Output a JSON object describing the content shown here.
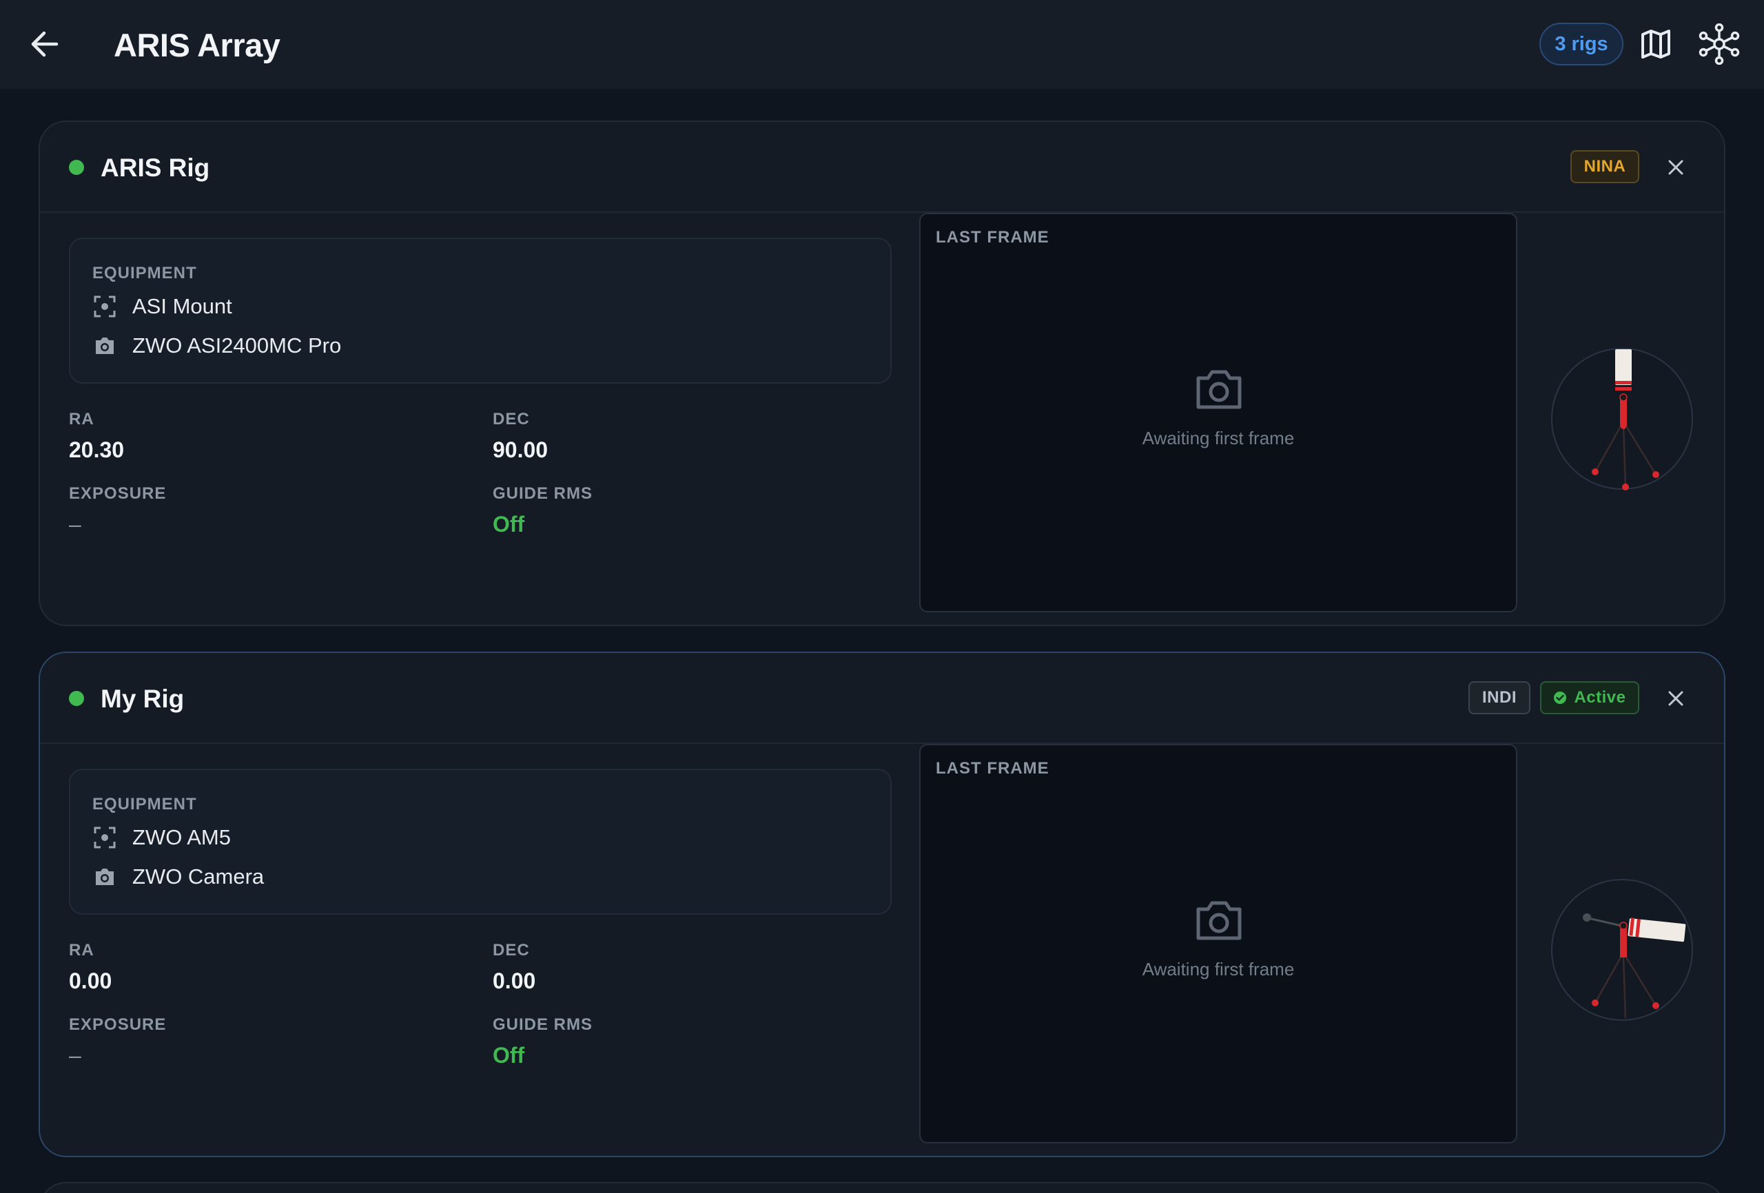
{
  "header": {
    "title": "ARIS Array",
    "rigs_count": "3 rigs",
    "icons": [
      "arrow-left-icon",
      "map-icon",
      "network-icon"
    ]
  },
  "rigs": [
    {
      "name": "ARIS Rig",
      "status_color": "#3fb950",
      "tags": [
        "NINA"
      ],
      "equipment_label": "EQUIPMENT",
      "equipment": [
        "ASI Mount",
        "ZWO ASI2400MC Pro"
      ],
      "ra_label": "RA",
      "ra": "20.30",
      "dec_label": "DEC",
      "dec": "90.00",
      "exposure_label": "EXPOSURE",
      "exposure": "–",
      "guide_label": "GUIDE RMS",
      "guide": "Off",
      "frame_label": "LAST FRAME",
      "frame_status": "Awaiting first frame",
      "scope_orientation": "vertical"
    },
    {
      "name": "My Rig",
      "status_color": "#3fb950",
      "tags": [
        "INDI",
        "Active"
      ],
      "equipment_label": "EQUIPMENT",
      "equipment": [
        "ZWO AM5",
        "ZWO Camera"
      ],
      "ra_label": "RA",
      "ra": "0.00",
      "dec_label": "DEC",
      "dec": "0.00",
      "exposure_label": "EXPOSURE",
      "exposure": "–",
      "guide_label": "GUIDE RMS",
      "guide": "Off",
      "frame_label": "LAST FRAME",
      "frame_status": "Awaiting first frame",
      "scope_orientation": "horizontal"
    }
  ],
  "colors": {
    "accent_blue": "#4f9bf2",
    "online_green": "#3fb950",
    "nina_amber": "#e3a72f",
    "scope_red": "#d9272e"
  }
}
